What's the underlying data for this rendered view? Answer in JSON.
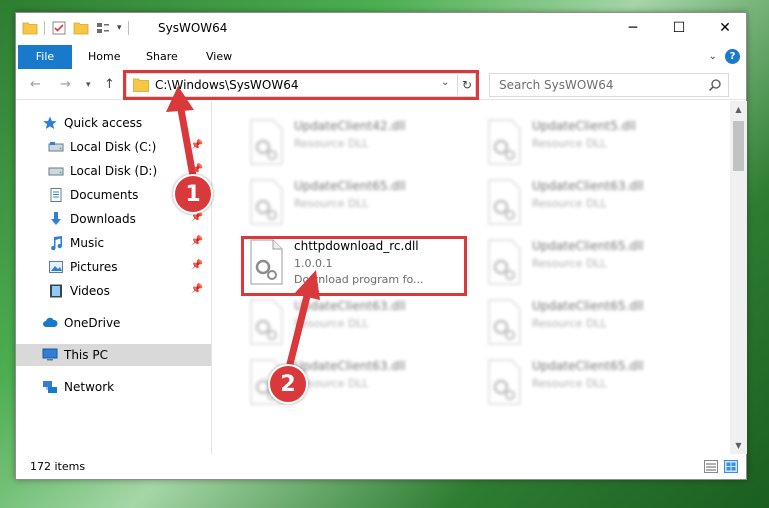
{
  "window": {
    "title": "SysWOW64",
    "controls": {
      "minimize": "─",
      "maximize": "☐",
      "close": "✕"
    }
  },
  "ribbon": {
    "tabs": [
      "File",
      "Home",
      "Share",
      "View"
    ],
    "help": "?"
  },
  "nav": {
    "address": "C:\\Windows\\SysWOW64",
    "search_placeholder": "Search SysWOW64"
  },
  "sidebar": {
    "items": [
      {
        "label": "Quick access",
        "icon": "star-icon"
      },
      {
        "label": "Local Disk (C:)",
        "icon": "drive-icon",
        "pinned": true
      },
      {
        "label": "Local Disk (D:)",
        "icon": "drive-icon",
        "pinned": true
      },
      {
        "label": "Documents",
        "icon": "documents-icon",
        "pinned": true
      },
      {
        "label": "Downloads",
        "icon": "downloads-icon",
        "pinned": true
      },
      {
        "label": "Music",
        "icon": "music-icon",
        "pinned": true
      },
      {
        "label": "Pictures",
        "icon": "pictures-icon",
        "pinned": true
      },
      {
        "label": "Videos",
        "icon": "videos-icon",
        "pinned": true
      },
      {
        "label": "OneDrive",
        "icon": "cloud-icon"
      },
      {
        "label": "This PC",
        "icon": "computer-icon",
        "selected": true
      },
      {
        "label": "Network",
        "icon": "network-icon"
      }
    ]
  },
  "files": [
    {
      "name": "UpdateClient42.dll",
      "line1": "Resource DLL",
      "line2": "",
      "blurred": true
    },
    {
      "name": "UpdateClient5.dll",
      "line1": "Resource DLL",
      "line2": "",
      "blurred": true
    },
    {
      "name": "UpdateClient65.dll",
      "line1": "Resource DLL",
      "line2": "",
      "blurred": true
    },
    {
      "name": "UpdateClient63.dll",
      "line1": "Resource DLL",
      "line2": "",
      "blurred": true
    },
    {
      "name": "chttpdownload_rc.dll",
      "line1": "1.0.0.1",
      "line2": "Download program fo...",
      "blurred": false
    },
    {
      "name": "UpdateClient65.dll",
      "line1": "Resource DLL",
      "line2": "",
      "blurred": true
    },
    {
      "name": "UpdateClient63.dll",
      "line1": "Resource DLL",
      "line2": "",
      "blurred": true
    },
    {
      "name": "UpdateClient65.dll",
      "line1": "Resource DLL",
      "line2": "",
      "blurred": true
    },
    {
      "name": "UpdateClient63.dll",
      "line1": "Resource DLL",
      "line2": "",
      "blurred": true
    },
    {
      "name": "UpdateClient65.dll",
      "line1": "Resource DLL",
      "line2": "",
      "blurred": true
    }
  ],
  "status": {
    "item_count": "172 items"
  },
  "callouts": [
    "1",
    "2"
  ],
  "colors": {
    "accent": "#1979ca",
    "highlight": "#d9393b",
    "selected": "#d9d9d9"
  }
}
